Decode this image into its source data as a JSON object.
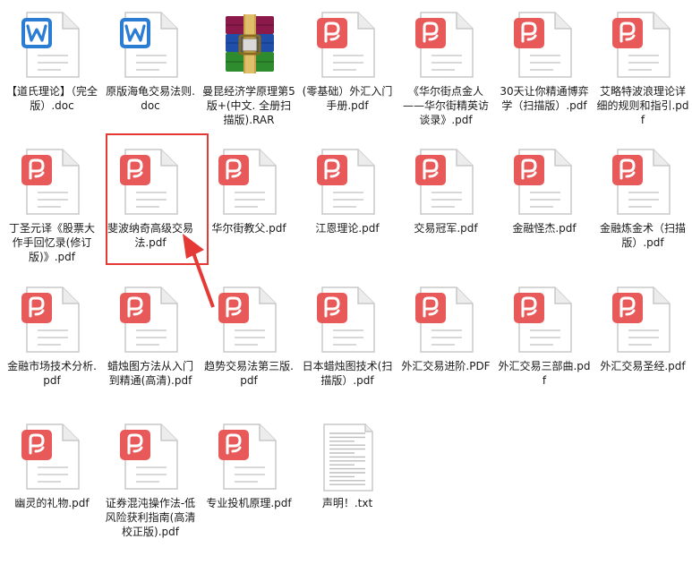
{
  "files": [
    {
      "name": "【道氏理论】（完全版）.doc",
      "type": "doc"
    },
    {
      "name": "原版海龟交易法则.doc",
      "type": "doc"
    },
    {
      "name": "曼昆经济学原理第5版+(中文. 全册扫描版).RAR",
      "type": "rar"
    },
    {
      "name": "(零基础）外汇入门手册.pdf",
      "type": "pdf"
    },
    {
      "name": "《华尔街点金人——华尔街精英访谈录》.pdf",
      "type": "pdf"
    },
    {
      "name": "30天让你精通博弈学（扫描版）.pdf",
      "type": "pdf"
    },
    {
      "name": "艾略特波浪理论详细的规则和指引.pdf",
      "type": "pdf"
    },
    {
      "name": "丁圣元译《股票大作手回忆录(修订版)》.pdf",
      "type": "pdf"
    },
    {
      "name": "斐波纳奇高级交易法.pdf",
      "type": "pdf",
      "highlighted": true
    },
    {
      "name": "华尔街教父.pdf",
      "type": "pdf"
    },
    {
      "name": "江恩理论.pdf",
      "type": "pdf"
    },
    {
      "name": "交易冠军.pdf",
      "type": "pdf"
    },
    {
      "name": "金融怪杰.pdf",
      "type": "pdf"
    },
    {
      "name": "金融炼金术（扫描版）.pdf",
      "type": "pdf"
    },
    {
      "name": "金融市场技术分析.pdf",
      "type": "pdf"
    },
    {
      "name": "蜡烛图方法从入门到精通(高清).pdf",
      "type": "pdf"
    },
    {
      "name": "趋势交易法第三版.pdf",
      "type": "pdf"
    },
    {
      "name": "日本蜡烛图技术(扫描版）.pdf",
      "type": "pdf"
    },
    {
      "name": "外汇交易进阶.PDF",
      "type": "pdf"
    },
    {
      "name": "外汇交易三部曲.pdf",
      "type": "pdf"
    },
    {
      "name": "外汇交易圣经.pdf",
      "type": "pdf"
    },
    {
      "name": "幽灵的礼物.pdf",
      "type": "pdf"
    },
    {
      "name": "证券混沌操作法-低风险获利指南(高清校正版).pdf",
      "type": "pdf"
    },
    {
      "name": "专业投机原理.pdf",
      "type": "pdf"
    },
    {
      "name": "声明！.txt",
      "type": "txt"
    }
  ],
  "colors": {
    "pdf_badge": "#e85a5a",
    "doc_badge": "#2b7cd3",
    "highlight": "#e53935"
  },
  "icons": {
    "doc": "word-doc-icon",
    "pdf": "pdf-file-icon",
    "rar": "winrar-archive-icon",
    "txt": "text-file-icon"
  }
}
